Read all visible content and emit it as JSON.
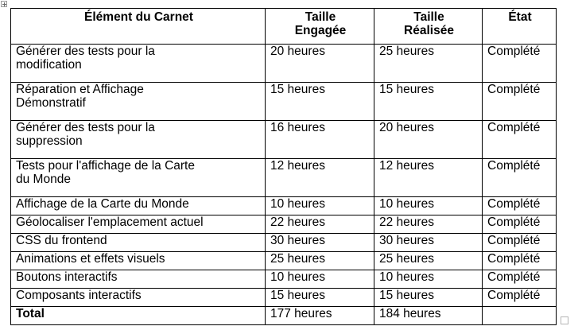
{
  "table": {
    "headers": [
      [
        "Élément du Carnet"
      ],
      [
        "Taille",
        "Engagée"
      ],
      [
        "Taille",
        "Réalisée"
      ],
      [
        "État"
      ]
    ],
    "rows": [
      {
        "item": [
          "Générer des tests pour la",
          "modification"
        ],
        "engagee": "20 heures",
        "realisee": "25 heures",
        "etat": "Complété"
      },
      {
        "item": [
          "Réparation et Affichage",
          "Démonstratif"
        ],
        "engagee": "15 heures",
        "realisee": "15 heures",
        "etat": "Complété"
      },
      {
        "item": [
          "Générer des tests pour la",
          "suppression"
        ],
        "engagee": "16 heures",
        "realisee": "20 heures",
        "etat": "Complété"
      },
      {
        "item": [
          "Tests pour l'affichage de la Carte",
          "du Monde"
        ],
        "engagee": "12 heures",
        "realisee": "12 heures",
        "etat": "Complété"
      },
      {
        "item": [
          "Affichage de la Carte du Monde"
        ],
        "engagee": "10 heures",
        "realisee": "10 heures",
        "etat": "Complété"
      },
      {
        "item": [
          "Géolocaliser l'emplacement actuel"
        ],
        "engagee": "22 heures",
        "realisee": "22 heures",
        "etat": "Complété"
      },
      {
        "item": [
          "CSS du frontend"
        ],
        "engagee": "30 heures",
        "realisee": "30 heures",
        "etat": "Complété"
      },
      {
        "item": [
          "Animations et effets visuels"
        ],
        "engagee": "25 heures",
        "realisee": "25 heures",
        "etat": "Complété"
      },
      {
        "item": [
          "Boutons interactifs"
        ],
        "engagee": "10 heures",
        "realisee": "10 heures",
        "etat": "Complété"
      },
      {
        "item": [
          "Composants interactifs"
        ],
        "engagee": "15 heures",
        "realisee": "15 heures",
        "etat": "Complété"
      }
    ],
    "total": {
      "label": "Total",
      "engagee": "177 heures",
      "realisee": "184 heures",
      "etat": ""
    }
  },
  "icons": {
    "move_handle": "table-move-handle-icon",
    "resize_handle": "table-resize-handle-icon"
  }
}
